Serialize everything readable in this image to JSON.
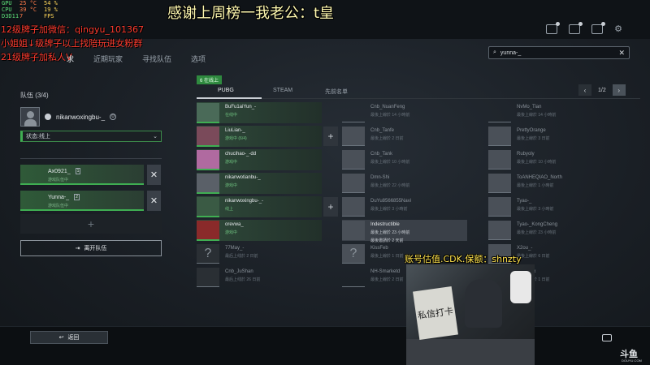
{
  "overlay": {
    "hud": [
      {
        "k": "GPU",
        "v": "25 °C",
        "v2": "54 %"
      },
      {
        "k": "CPU",
        "v": "39 °C",
        "v2": "19 %"
      },
      {
        "k": "D3D11",
        "v": "7",
        "v2": "FPS"
      }
    ],
    "thanks_banner": "感谢上周榜一我老公：t皇",
    "red_lines": [
      "12级牌子加微信：qingyu_101367",
      "小姐姐↓级牌子以上找陪玩进女粉群",
      "21级牌子加私人V"
    ],
    "cam_banner": "账号估值.CDK.保额：shnzty",
    "cam_sign": "私信打卡"
  },
  "top_icons": [
    "friends-icon",
    "mail-icon",
    "notification-icon",
    "settings-icon"
  ],
  "nav_tabs": [
    {
      "label": "求",
      "active": true
    },
    {
      "label": "近期玩家",
      "active": false
    },
    {
      "label": "寻找队伍",
      "active": false
    },
    {
      "label": "选项",
      "active": false
    }
  ],
  "search": {
    "value": "yunna-_",
    "clear": "✕"
  },
  "team": {
    "title": "队伍 (3/4)",
    "me": {
      "name": "nikanwoxingbu-_",
      "badge": "0"
    },
    "status": "状态:线上",
    "members": [
      {
        "name": "Ax0921_",
        "lvl": "1",
        "sub": "游戏队伍中"
      },
      {
        "name": "Yunna-_",
        "lvl": "2",
        "sub": "游戏队伍中"
      }
    ],
    "add": "+",
    "leave_label": "离开队伍"
  },
  "friends": {
    "online_tag": "6 在线上",
    "subtabs": [
      "PUBG",
      "STEAM",
      "先前名单"
    ],
    "page": "1/2",
    "col1": [
      {
        "name": "BuFu1aiYun_-",
        "sub": "在线中",
        "state": "on"
      },
      {
        "name": "LiuLian-_",
        "sub": "游戏中 (6/4)",
        "state": "on"
      },
      {
        "name": "chucihao-_-dd",
        "sub": "游戏中",
        "state": "on"
      },
      {
        "name": "nikanwotianbu-_",
        "sub": "游戏中",
        "state": "on"
      },
      {
        "name": "nikanwoxingbu-_-",
        "sub": "线上",
        "state": "on"
      },
      {
        "name": "orevwa_",
        "sub": "游戏中",
        "state": "on"
      },
      {
        "name": "77May_-",
        "sub": "最后上线於 2 日前",
        "state": "off"
      },
      {
        "name": "Cnb_JuShan",
        "sub": "最后上线於 26 日前",
        "state": "off"
      }
    ],
    "col2": [
      {
        "name": "Cnb_NuanFeng",
        "sub": "最後上線於 14 小時前",
        "state": "off"
      },
      {
        "name": "Cnb_Tanfe",
        "sub": "最後上線於 2 日前",
        "state": "off"
      },
      {
        "name": "Cnb_Tank",
        "sub": "最後上線於 10 小時前",
        "state": "off"
      },
      {
        "name": "Dmn-Shi",
        "sub": "最後上線於 22 小時前",
        "state": "off"
      },
      {
        "name": "DuYu8566855Navi",
        "sub": "最後上線於 3 小時前",
        "state": "off"
      },
      {
        "name": "Indestructible",
        "sub": "最後上線於 23 小時前",
        "state": "hl",
        "sub2": "最後邀請於 2 天前"
      },
      {
        "name": "KissFeb",
        "sub": "最後上線於 1 日前",
        "state": "off"
      },
      {
        "name": "NH-Smarketd",
        "sub": "最後上線於 2 日前",
        "state": "off"
      }
    ],
    "col3": [
      {
        "name": "NvMo_Tian",
        "sub": "最後上線於 14 小時前",
        "state": "off"
      },
      {
        "name": "PrettyOrange",
        "sub": "最後上線於 3 日前",
        "state": "off"
      },
      {
        "name": "Rubyoly",
        "sub": "最後上線於 10 小時前",
        "state": "off"
      },
      {
        "name": "ToANHEQIAO_North",
        "sub": "最後上線於 1 小時前",
        "state": "off"
      },
      {
        "name": "Tyao-_",
        "sub": "最後上線於 3 小時前",
        "state": "off"
      },
      {
        "name": "Tyao-_KongCheng",
        "sub": "最後上線於 23 小時前",
        "state": "off"
      },
      {
        "name": "X2ou_-",
        "sub": "最後上線於 6 日前",
        "state": "off"
      },
      {
        "name": "ghu_Vxx",
        "sub": "最後上線於 1 日前",
        "state": "off"
      }
    ]
  },
  "bottom": {
    "back_label": "返回",
    "brand": "斗鱼",
    "brand_sub": "DOUYU.COM"
  },
  "colors": {
    "online_green": "#3fae52",
    "banner_yellow": "#fff9b0",
    "red_text": "#ff3b2e"
  }
}
